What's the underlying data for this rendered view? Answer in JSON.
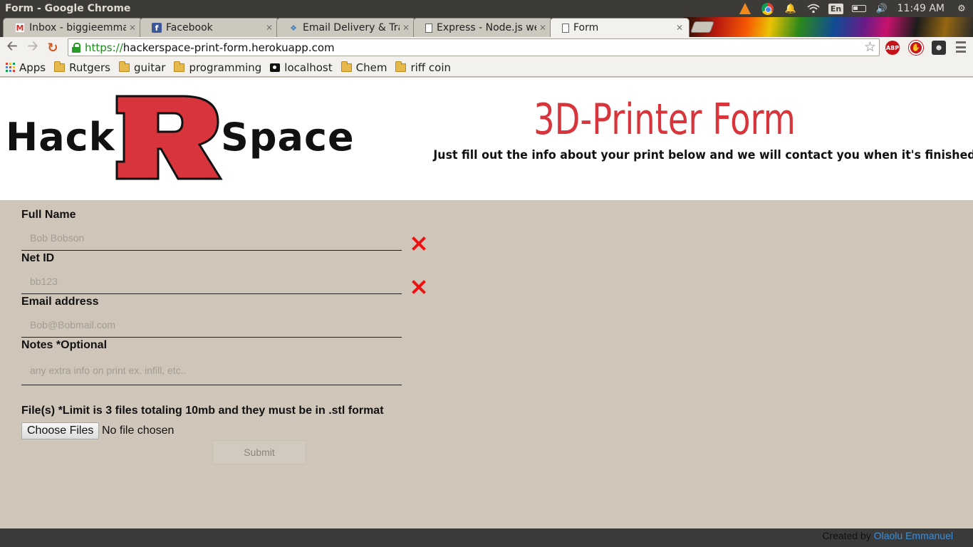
{
  "window": {
    "title": "Form - Google Chrome",
    "clock": "11:49 AM",
    "keyboard_layout": "En",
    "tray_icons": [
      "vlc-icon",
      "chrome-icon",
      "notification-bell-icon",
      "wifi-icon",
      "keyboard-layout-icon",
      "battery-icon",
      "volume-icon",
      "gear-icon"
    ]
  },
  "tabs": [
    {
      "label": "Inbox - biggieemmanuel",
      "icon": "gmail-icon"
    },
    {
      "label": "Facebook",
      "icon": "facebook-icon"
    },
    {
      "label": "Email Delivery & Transactional",
      "icon": "sendgrid-icon"
    },
    {
      "label": "Express - Node.js web",
      "icon": "document-icon"
    },
    {
      "label": "Form",
      "icon": "document-icon",
      "active": true
    }
  ],
  "toolbar": {
    "url_scheme": "https://",
    "url_host": "hackerspace-print-form.herokuapp.com",
    "abp_label": "ABP",
    "colors": {
      "secure": "#1a8a1a",
      "abp": "#c6131b"
    }
  },
  "bookmarks": [
    {
      "label": "Apps",
      "icon": "apps-grid-icon"
    },
    {
      "label": "Rutgers",
      "icon": "folder-icon"
    },
    {
      "label": "guitar",
      "icon": "folder-icon"
    },
    {
      "label": "programming",
      "icon": "folder-icon"
    },
    {
      "label": "localhost",
      "icon": "camera-icon"
    },
    {
      "label": "Chem",
      "icon": "folder-icon"
    },
    {
      "label": "riff coin",
      "icon": "folder-icon"
    }
  ],
  "header": {
    "logo_left": "Hack",
    "logo_letter": "R",
    "logo_right": "Space",
    "title": "3D-Printer Form",
    "subtitle": "Just fill out the info about your print below and we will contact you when it's finished!",
    "colors": {
      "accent": "#d8343c"
    }
  },
  "form": {
    "full_name": {
      "label": "Full Name",
      "placeholder": "Bob Bobson",
      "value": "",
      "invalid": true
    },
    "net_id": {
      "label": "Net ID",
      "placeholder": "bb123",
      "value": "",
      "invalid": true
    },
    "email": {
      "label": "Email address",
      "placeholder": "Bob@Bobmail.com",
      "value": ""
    },
    "notes": {
      "label": "Notes *Optional",
      "placeholder": "any extra info on print ex. infill, etc..",
      "value": ""
    },
    "files": {
      "label": "File(s) *Limit is 3 files totaling 10mb and they must be in .stl format",
      "button": "Choose Files",
      "status": "No file chosen"
    },
    "submit": "Submit",
    "colors": {
      "page_bg": "#cfc6b9",
      "error": "#ee1111"
    }
  },
  "footer": {
    "credit_prefix": "Created by",
    "credit_name": "Olaolu Emmanuel",
    "colors": {
      "link": "#3a8fd8"
    }
  }
}
